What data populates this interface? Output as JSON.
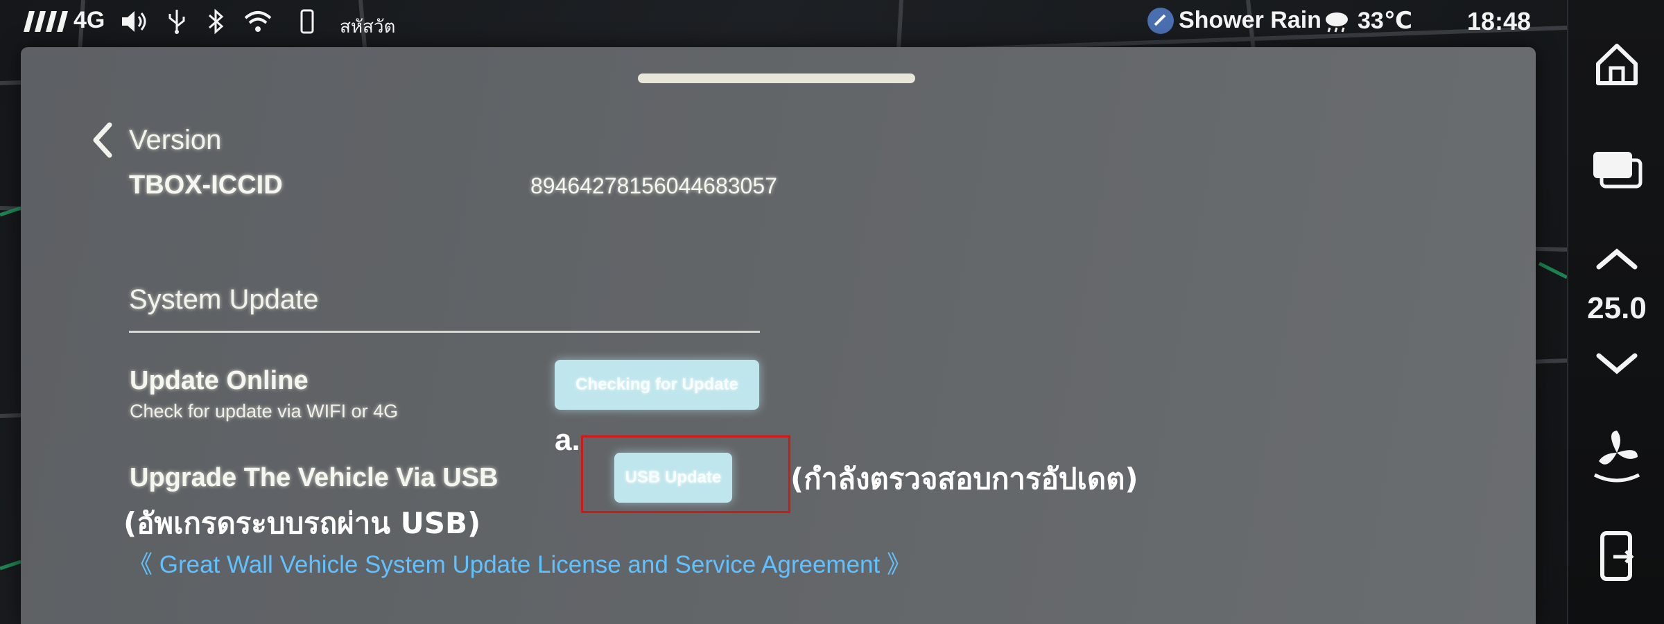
{
  "status_bar": {
    "network": "4G",
    "location_text": "สหัสวัต",
    "weather": "Shower Rain",
    "temperature": "33℃",
    "time": "18:48"
  },
  "dock": {
    "temperature_setting": "25.0",
    "icons": [
      "home-icon",
      "windows-icon",
      "chevron-up-icon",
      "chevron-down-icon",
      "fan-icon",
      "phone-icon"
    ]
  },
  "panel": {
    "title": "Version",
    "iccid_label": "TBOX-ICCID",
    "iccid_value": "89464278156044683057",
    "section_title": "System Update",
    "update_online": {
      "title": "Update Online",
      "subtitle": "Check for update via WIFI or 4G",
      "button": "Checking for Update"
    },
    "usb_upgrade": {
      "title": "Upgrade The Vehicle Via USB",
      "button": "USB Update"
    },
    "license_link": "《 Great Wall Vehicle System Update License and Service Agreement 》"
  },
  "annotations": {
    "marker": "a.",
    "usb_thai": "(อัพเกรดระบบรถผ่าน USB)",
    "checking_thai": "(กำลังตรวจสอบการอัปเดต)",
    "highlight_color": "#d01a1a"
  },
  "colors": {
    "button_bg": "#bfe6ec",
    "link": "#5fc1ff",
    "panel_bg": "#606366"
  }
}
